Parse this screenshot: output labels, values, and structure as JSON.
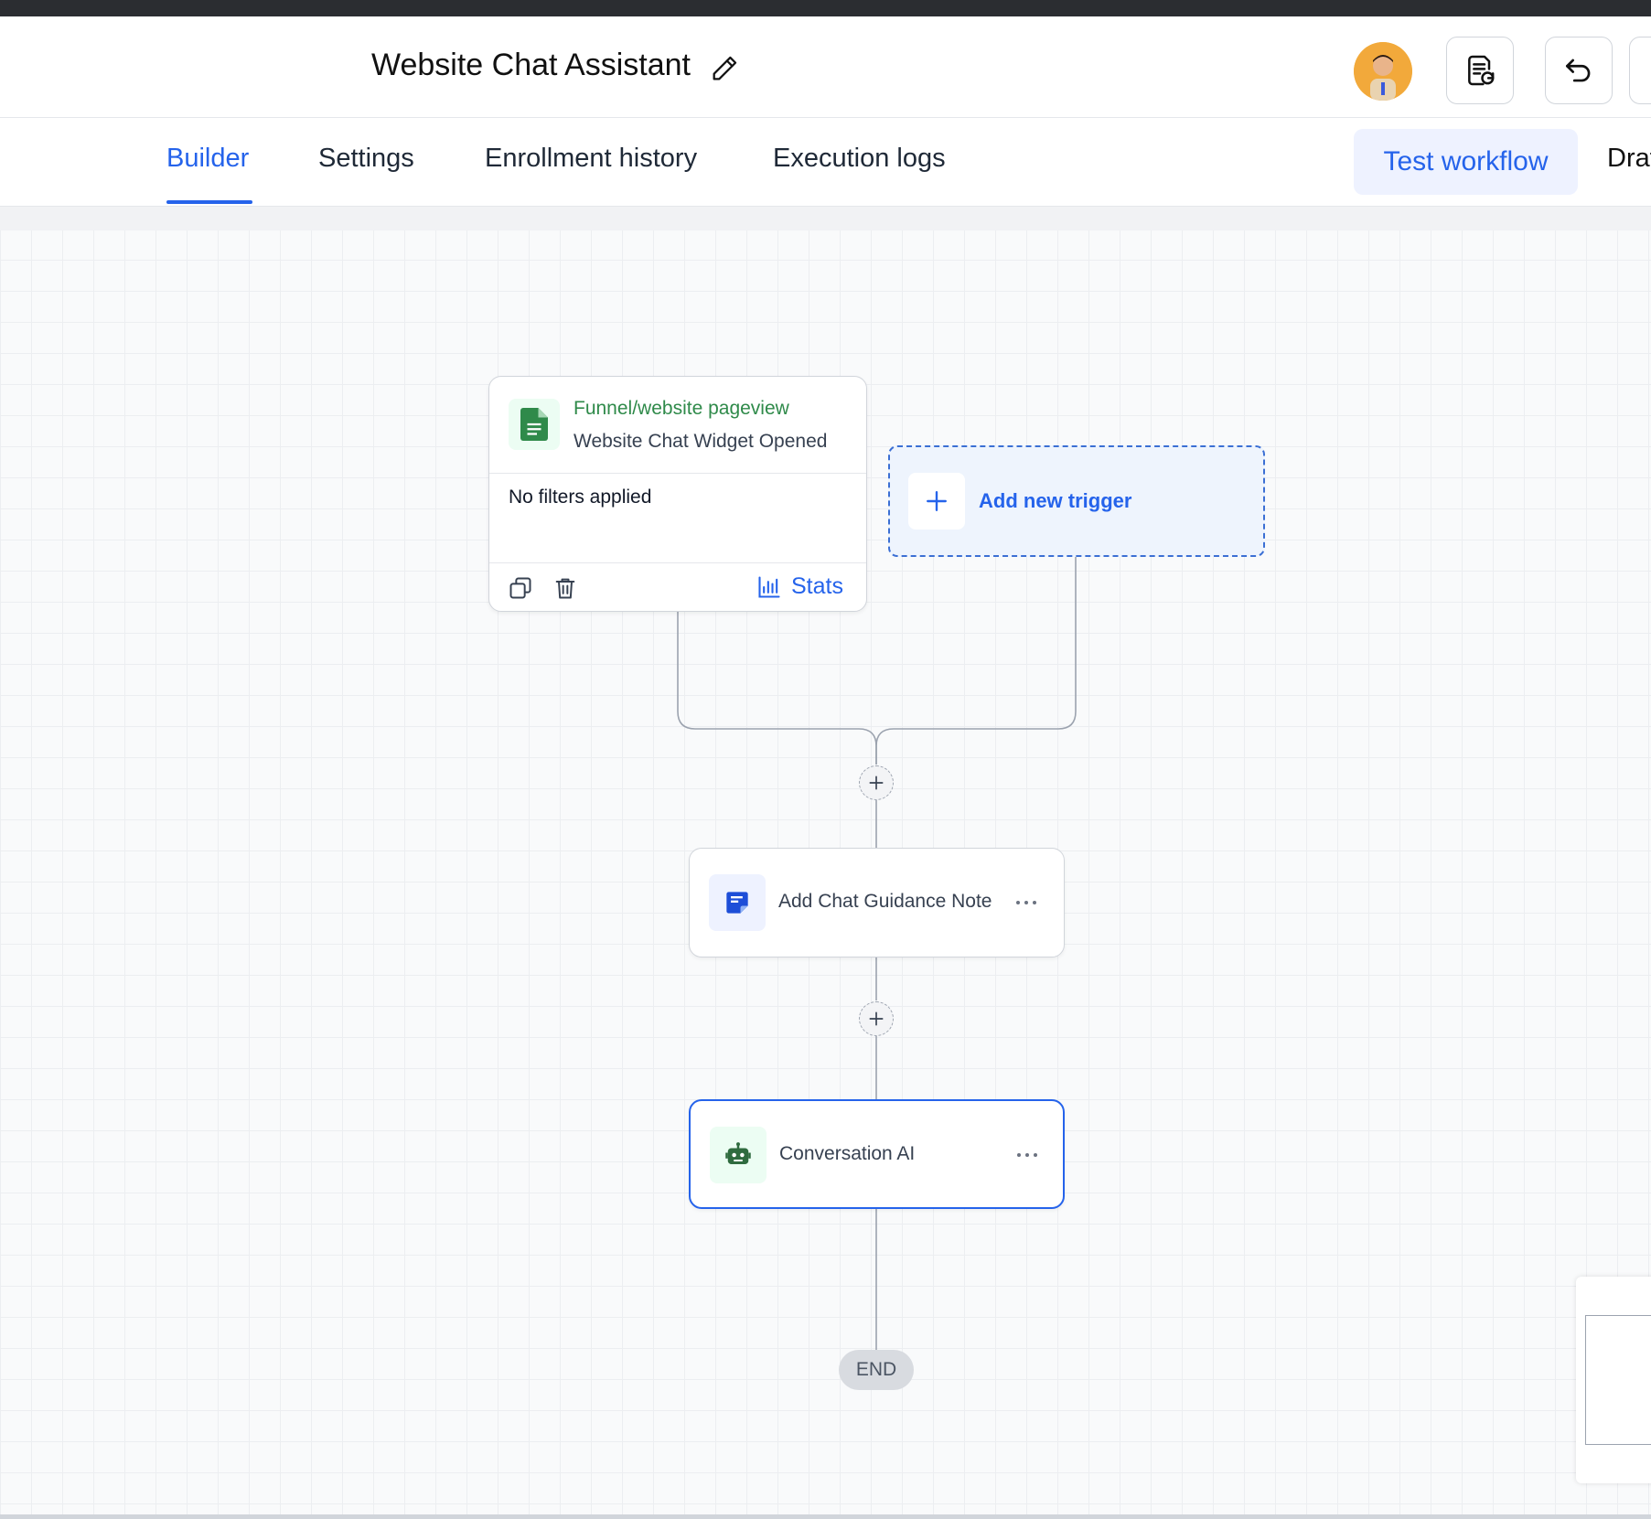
{
  "header": {
    "workflow_title": "Website Chat Assistant",
    "edit_icon": "pencil-icon",
    "avatar_icon": "user-avatar",
    "buttons": [
      {
        "icon": "document-refresh-icon"
      },
      {
        "icon": "undo-icon"
      }
    ]
  },
  "tabs": {
    "items": [
      {
        "label": "Builder",
        "active": true
      },
      {
        "label": "Settings",
        "active": false
      },
      {
        "label": "Enrollment history",
        "active": false
      },
      {
        "label": "Execution logs",
        "active": false
      }
    ],
    "test_workflow_label": "Test workflow",
    "draft_label": "Draf"
  },
  "canvas": {
    "trigger": {
      "type_label": "Funnel/website pageview",
      "name": "Website Chat Widget Opened",
      "filters_text": "No filters applied",
      "stats_label": "Stats",
      "icon": "document-icon"
    },
    "add_trigger_label": "Add new trigger",
    "actions": [
      {
        "label": "Add Chat Guidance Note",
        "icon": "note-icon",
        "selected": false
      },
      {
        "label": "Conversation AI",
        "icon": "robot-icon",
        "selected": true
      }
    ],
    "end_label": "END"
  },
  "colors": {
    "accent": "#2563eb",
    "trigger_green": "#2f8a4a",
    "canvas_bg": "#f9fafb"
  }
}
